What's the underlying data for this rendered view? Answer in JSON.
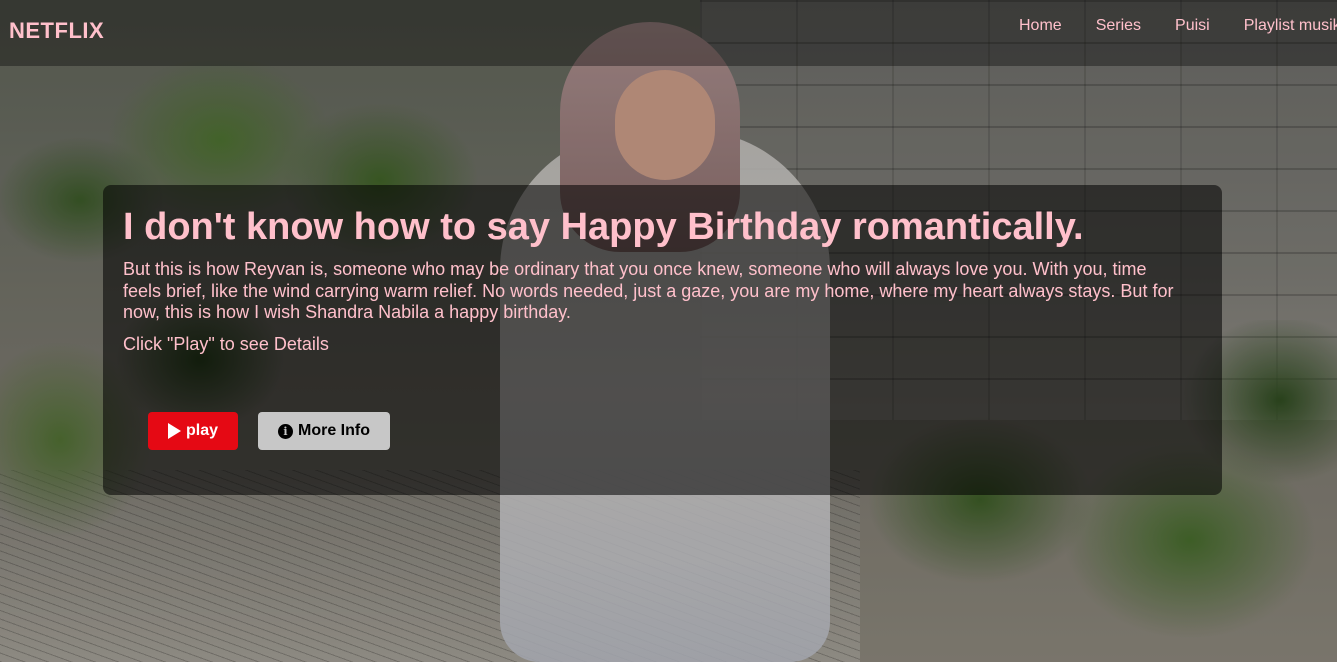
{
  "brand": {
    "name": "NETFLIX",
    "accent_color": "#ffc0cb"
  },
  "nav": {
    "items": [
      {
        "label": "Home"
      },
      {
        "label": "Series"
      },
      {
        "label": "Puisi"
      },
      {
        "label": "Playlist musik"
      }
    ]
  },
  "hero": {
    "title": "I don't know how to say Happy Birthday romantically.",
    "description": "But this is how Reyvan is, someone who may be ordinary that you once knew, someone who will always love you. With you, time feels brief, like the wind carrying warm relief. No words needed, just a gaze, you are my home, where my heart always stays. But for now, this is how I wish Shandra Nabila a happy birthday.",
    "hint": "Click \"Play\" to see Details",
    "play_label": "play",
    "info_label": "More Info",
    "play_color": "#e50914",
    "info_color": "#c7c7c7"
  },
  "icons": {
    "play": "play-icon",
    "info": "info-circle-icon"
  }
}
